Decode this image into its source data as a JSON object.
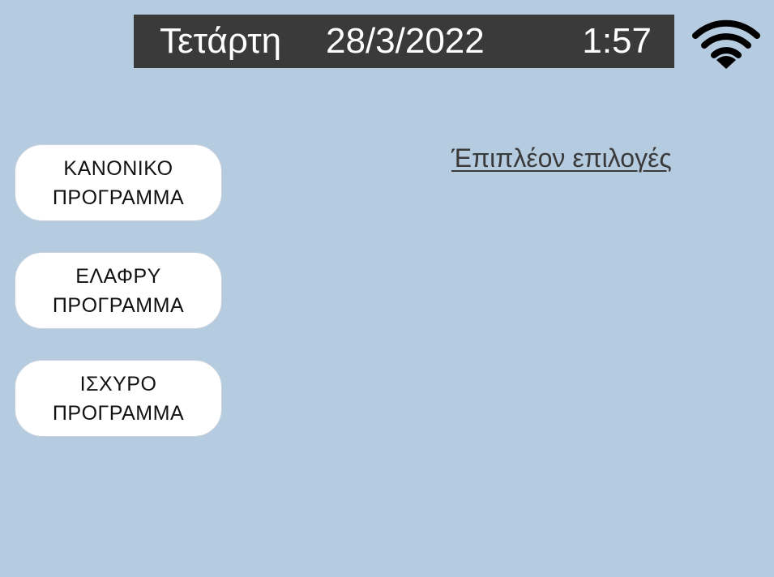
{
  "status_bar": {
    "day": "Τετάρτη",
    "date": "28/3/2022",
    "time": "1:57",
    "wifi_icon": "wifi-icon"
  },
  "programs": [
    {
      "line1": "ΚΑΝΟΝΙΚΟ",
      "line2": "ΠΡΟΓΡΑΜΜΑ"
    },
    {
      "line1": "ΕΛΑΦΡΥ",
      "line2": "ΠΡΟΓΡΑΜΜΑ"
    },
    {
      "line1": "ΙΣΧΥΡΟ",
      "line2": "ΠΡΟΓΡΑΜΜΑ"
    }
  ],
  "more_options_link": "Έπιπλέον επιλογές",
  "colors": {
    "background": "#b5cbe0",
    "status_bar": "#3a3a3a",
    "button": "#ffffff"
  }
}
